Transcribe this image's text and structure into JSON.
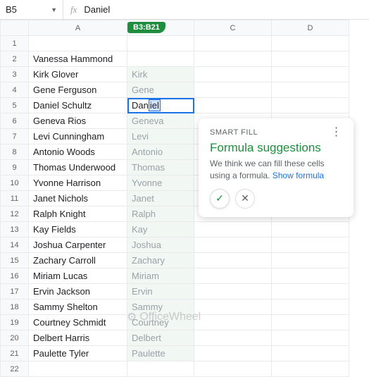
{
  "namebox": {
    "ref": "B5",
    "formula_value": "Daniel"
  },
  "range_badge": "B3:B21",
  "columns": [
    "A",
    "B",
    "C",
    "D"
  ],
  "rows": [
    {
      "n": 1,
      "a": "",
      "b": "",
      "ghost": false
    },
    {
      "n": 2,
      "a": "Vanessa Hammond",
      "b": "",
      "ghost": false
    },
    {
      "n": 3,
      "a": "Kirk Glover",
      "b": "Kirk",
      "ghost": true
    },
    {
      "n": 4,
      "a": "Gene Ferguson",
      "b": "Gene",
      "ghost": true
    },
    {
      "n": 5,
      "a": "Daniel Schultz",
      "b_typed": "Dan",
      "b_suggest": "iel",
      "active": true
    },
    {
      "n": 6,
      "a": "Geneva Rios",
      "b": "Geneva",
      "ghost": true
    },
    {
      "n": 7,
      "a": "Levi Cunningham",
      "b": "Levi",
      "ghost": true
    },
    {
      "n": 8,
      "a": "Antonio Woods",
      "b": "Antonio",
      "ghost": true
    },
    {
      "n": 9,
      "a": "Thomas Underwood",
      "b": "Thomas",
      "ghost": true
    },
    {
      "n": 10,
      "a": "Yvonne Harrison",
      "b": "Yvonne",
      "ghost": true
    },
    {
      "n": 11,
      "a": "Janet Nichols",
      "b": "Janet",
      "ghost": true
    },
    {
      "n": 12,
      "a": "Ralph Knight",
      "b": "Ralph",
      "ghost": true
    },
    {
      "n": 13,
      "a": "Kay Fields",
      "b": "Kay",
      "ghost": true
    },
    {
      "n": 14,
      "a": "Joshua Carpenter",
      "b": "Joshua",
      "ghost": true
    },
    {
      "n": 15,
      "a": "Zachary Carroll",
      "b": "Zachary",
      "ghost": true
    },
    {
      "n": 16,
      "a": "Miriam Lucas",
      "b": "Miriam",
      "ghost": true
    },
    {
      "n": 17,
      "a": "Ervin Jackson",
      "b": "Ervin",
      "ghost": true
    },
    {
      "n": 18,
      "a": "Sammy Shelton",
      "b": "Sammy",
      "ghost": true
    },
    {
      "n": 19,
      "a": "Courtney Schmidt",
      "b": "Courtney",
      "ghost": true
    },
    {
      "n": 20,
      "a": "Delbert Harris",
      "b": "Delbert",
      "ghost": true
    },
    {
      "n": 21,
      "a": "Paulette Tyler",
      "b": "Paulette",
      "ghost": true
    },
    {
      "n": 22,
      "a": "",
      "b": "",
      "ghost": false
    }
  ],
  "smartfill": {
    "label": "SMART FILL",
    "title": "Formula suggestions",
    "body": "We think we can fill these cells using a formula.",
    "link": "Show formula"
  },
  "watermark": "OfficeWheel"
}
